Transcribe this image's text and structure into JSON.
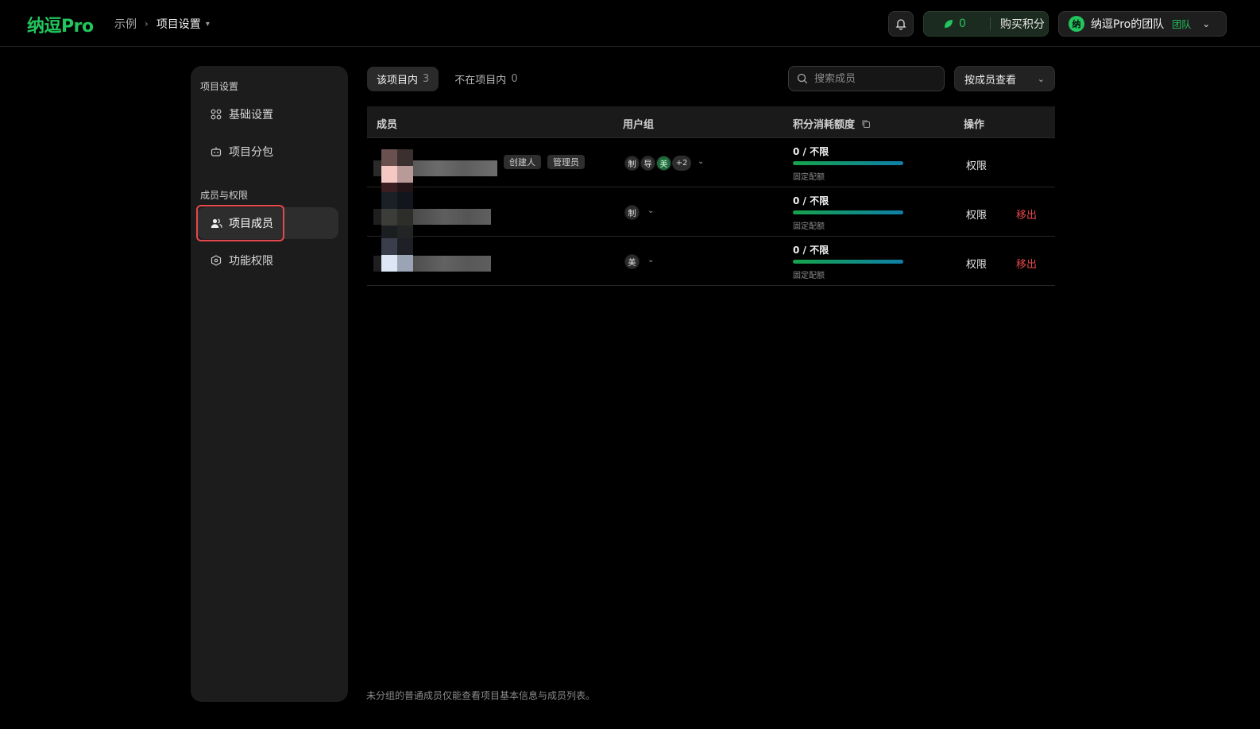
{
  "header": {
    "logo": "纳逗Pro",
    "breadcrumb": [
      "示例",
      "项目设置"
    ],
    "points_value": "0",
    "buy_points_label": "购买积分",
    "team_avatar_char": "纳",
    "team_name": "纳逗Pro的团队",
    "team_badge": "团队"
  },
  "sidebar": {
    "section_1": "项目设置",
    "item_basic": "基础设置",
    "item_subpkg": "项目分包",
    "section_2": "成员与权限",
    "item_members": "项目成员",
    "item_perms": "功能权限"
  },
  "tabs": {
    "in_project_label": "该项目内",
    "in_project_count": "3",
    "not_in_project_label": "不在项目内",
    "not_in_project_count": "0"
  },
  "search": {
    "placeholder": "搜索成员"
  },
  "view_select": {
    "value": "按成员查看"
  },
  "table": {
    "headers": {
      "member": "成员",
      "group": "用户组",
      "quota": "积分消耗额度",
      "actions": "操作"
    },
    "rows": [
      {
        "tags": [
          "创建人",
          "管理员"
        ],
        "groups": [
          "制",
          "导",
          "美"
        ],
        "more": "+2",
        "quota": "0 / 不限",
        "quota_note": "固定配额",
        "perm": "权限",
        "remove": ""
      },
      {
        "tags": [],
        "groups": [
          "制"
        ],
        "more": "",
        "quota": "0 / 不限",
        "quota_note": "固定配额",
        "perm": "权限",
        "remove": "移出"
      },
      {
        "tags": [],
        "groups": [
          "美"
        ],
        "more": "",
        "quota": "0 / 不限",
        "quota_note": "固定配额",
        "perm": "权限",
        "remove": "移出"
      }
    ]
  },
  "footer_note": "未分组的普通成员仅能查看项目基本信息与成员列表。",
  "colors": {
    "accent": "#22c55e",
    "danger": "#e5484d",
    "highlight_box": "#e5484d"
  },
  "icons": [
    "bell-icon",
    "leaf-icon",
    "chevron-down-icon",
    "grid-icon",
    "robot-icon",
    "users-icon",
    "hexagon-icon",
    "search-icon",
    "copy-icon"
  ]
}
